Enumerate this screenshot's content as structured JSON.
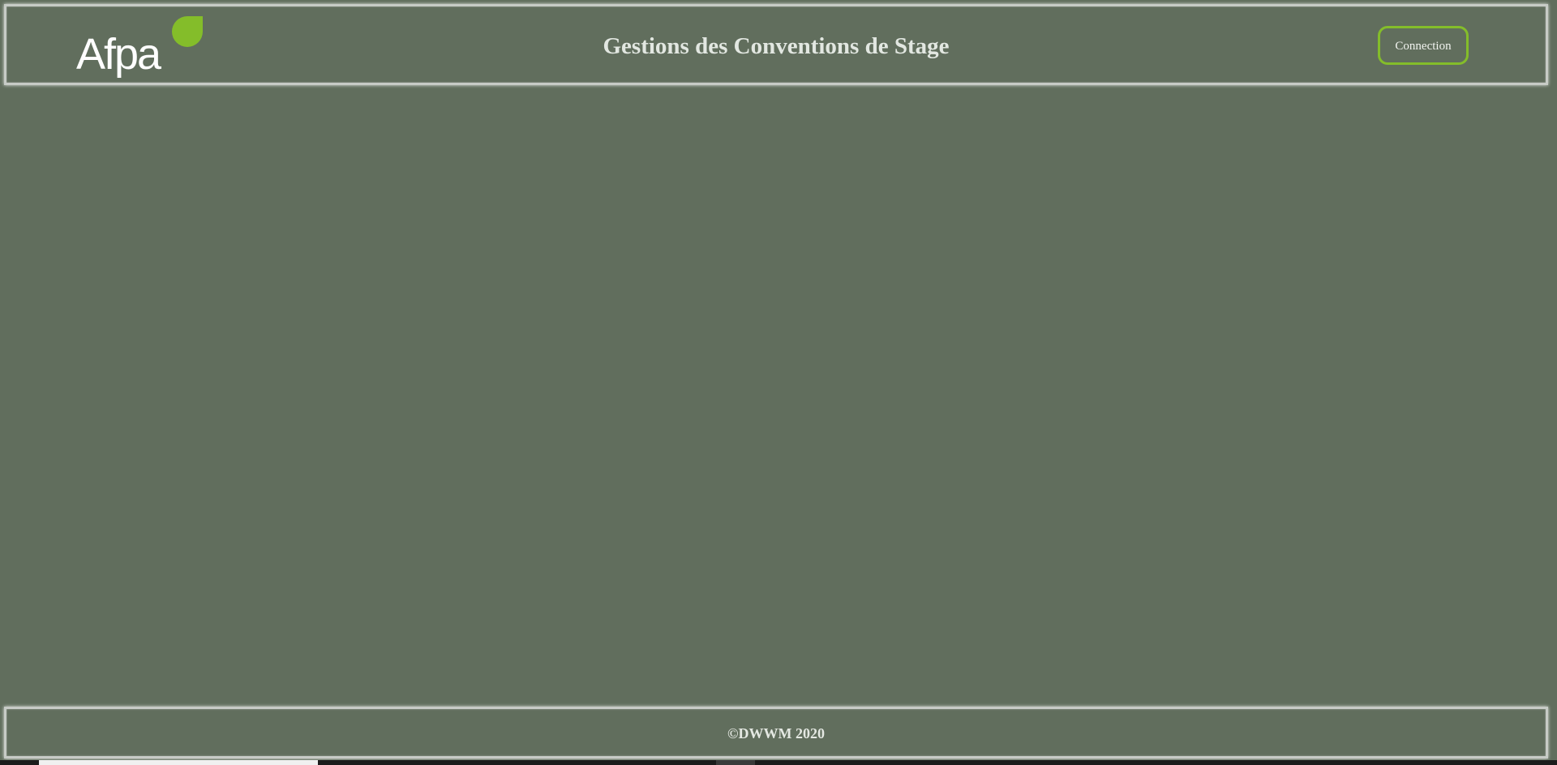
{
  "header": {
    "logo_text": "Afpa",
    "title": "Gestions des Conventions de Stage",
    "connect_label": "Connection"
  },
  "footer": {
    "copyright": "©DWWM 2020"
  },
  "colors": {
    "background": "#616e5d",
    "accent": "#84bd2a",
    "border": "#c7cbc6"
  }
}
